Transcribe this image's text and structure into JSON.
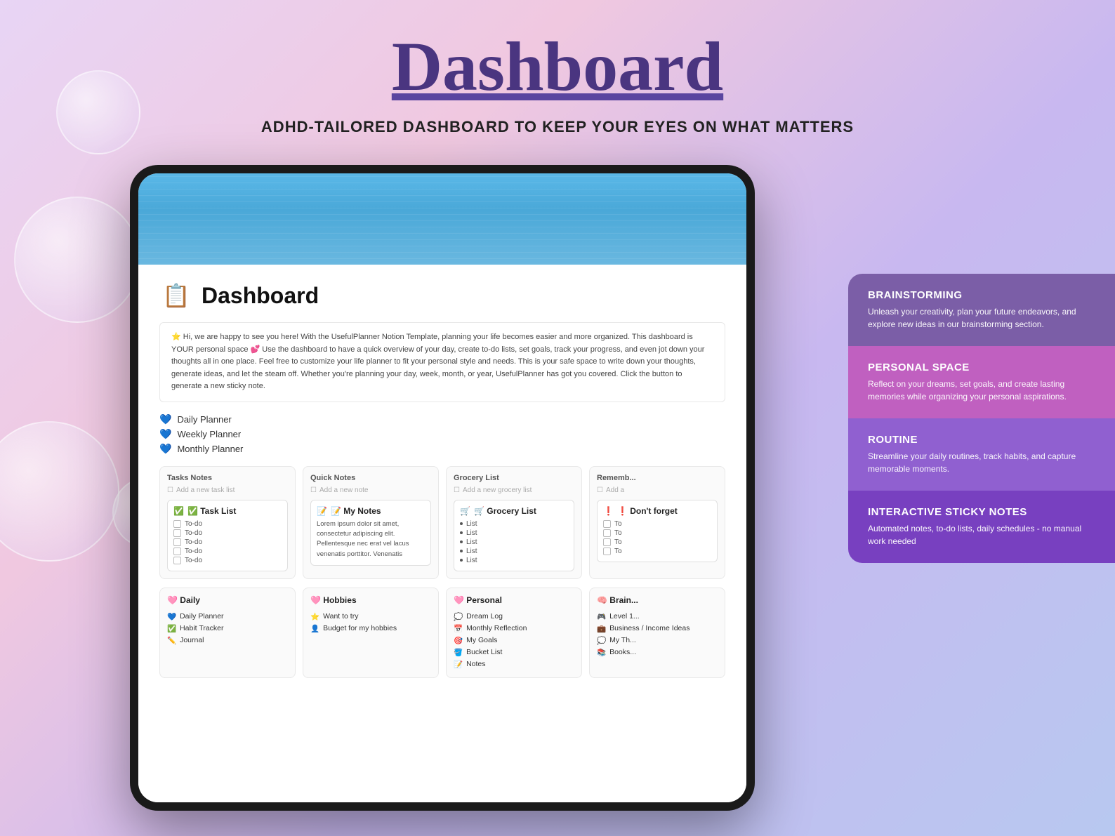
{
  "page": {
    "title": "Dashboard",
    "subtitle": "ADHD-TAILORED DASHBOARD TO KEEP YOUR EYES ON WHAT MATTERS"
  },
  "screen": {
    "page_icon": "📋",
    "page_title": "Dashboard",
    "welcome_text": "⭐ Hi, we are happy to see you here! With the UsefulPlanner Notion Template, planning your life becomes easier and more organized. This dashboard is YOUR personal space 💕 Use the dashboard to have a quick overview of your day, create to-do lists, set goals, track your progress, and even jot down your thoughts all in one place. Feel free to customize your life planner to fit your personal style and needs. This is your safe space to write down your thoughts, generate ideas, and let the steam off. Whether you're planning your day, week, month, or year, UsefulPlanner has got you covered. Click the button to generate a new sticky note.",
    "nav_links": [
      {
        "icon": "💙",
        "label": "Daily Planner"
      },
      {
        "icon": "💙",
        "label": "Weekly Planner"
      },
      {
        "icon": "💙",
        "label": "Monthly Planner"
      }
    ],
    "top_sections": [
      {
        "title": "Tasks Notes",
        "add_label": "Add a new task list",
        "card_title": "✅ Task List",
        "card_items": [
          "To-do",
          "To-do",
          "To-do",
          "To-do",
          "To-do"
        ]
      },
      {
        "title": "Quick Notes",
        "add_label": "Add a new note",
        "card_title": "📝 My Notes",
        "card_text": "Lorem ipsum dolor sit amet, consectetur adipiscing elit. Pellentesque nec erat vel lacus venenatis porttitor. Venenatis"
      },
      {
        "title": "Grocery List",
        "add_label": "Add a new grocery list",
        "card_title": "🛒 Grocery List",
        "card_items": [
          "List",
          "List",
          "List",
          "List",
          "List"
        ]
      },
      {
        "title": "Rememb...",
        "add_label": "Add a",
        "card_title": "❗ Don't forget",
        "card_items": [
          "To",
          "To",
          "To",
          "To"
        ]
      }
    ],
    "bottom_sections": [
      {
        "title": "🩷 Daily",
        "items": [
          {
            "icon": "💙",
            "label": "Daily Planner"
          },
          {
            "icon": "✅",
            "label": "Habit Tracker"
          },
          {
            "icon": "✏️",
            "label": "Journal"
          }
        ]
      },
      {
        "title": "🩷 Hobbies",
        "items": [
          {
            "icon": "⭐",
            "label": "Want to try"
          },
          {
            "icon": "👤",
            "label": "Budget for my hobbies"
          }
        ]
      },
      {
        "title": "🩷 Personal",
        "items": [
          {
            "icon": "💭",
            "label": "Dream Log"
          },
          {
            "icon": "📅",
            "label": "Monthly Reflection"
          },
          {
            "icon": "🎯",
            "label": "My Goals"
          },
          {
            "icon": "🪣",
            "label": "Bucket List"
          },
          {
            "icon": "📝",
            "label": "Notes"
          }
        ]
      },
      {
        "title": "🧠 Brain...",
        "items": [
          {
            "icon": "🎮",
            "label": "Level 1..."
          },
          {
            "icon": "💼",
            "label": "Business / Income Ideas"
          },
          {
            "icon": "💭",
            "label": "My Th..."
          },
          {
            "icon": "📚",
            "label": "Books..."
          }
        ]
      }
    ]
  },
  "features": [
    {
      "title": "BRAINSTORMING",
      "desc": "Unleash your creativity, plan your future endeavors, and explore new ideas in our brainstorming section."
    },
    {
      "title": "PERSONAL SPACE",
      "desc": "Reflect on your dreams, set goals, and create lasting memories while organizing your personal aspirations."
    },
    {
      "title": "ROUTINE",
      "desc": "Streamline your daily routines, track habits, and capture memorable moments."
    },
    {
      "title": "INTERACTIVE STICKY NOTES",
      "desc": "Automated notes, to-do lists, daily schedules - no manual work needed"
    }
  ]
}
